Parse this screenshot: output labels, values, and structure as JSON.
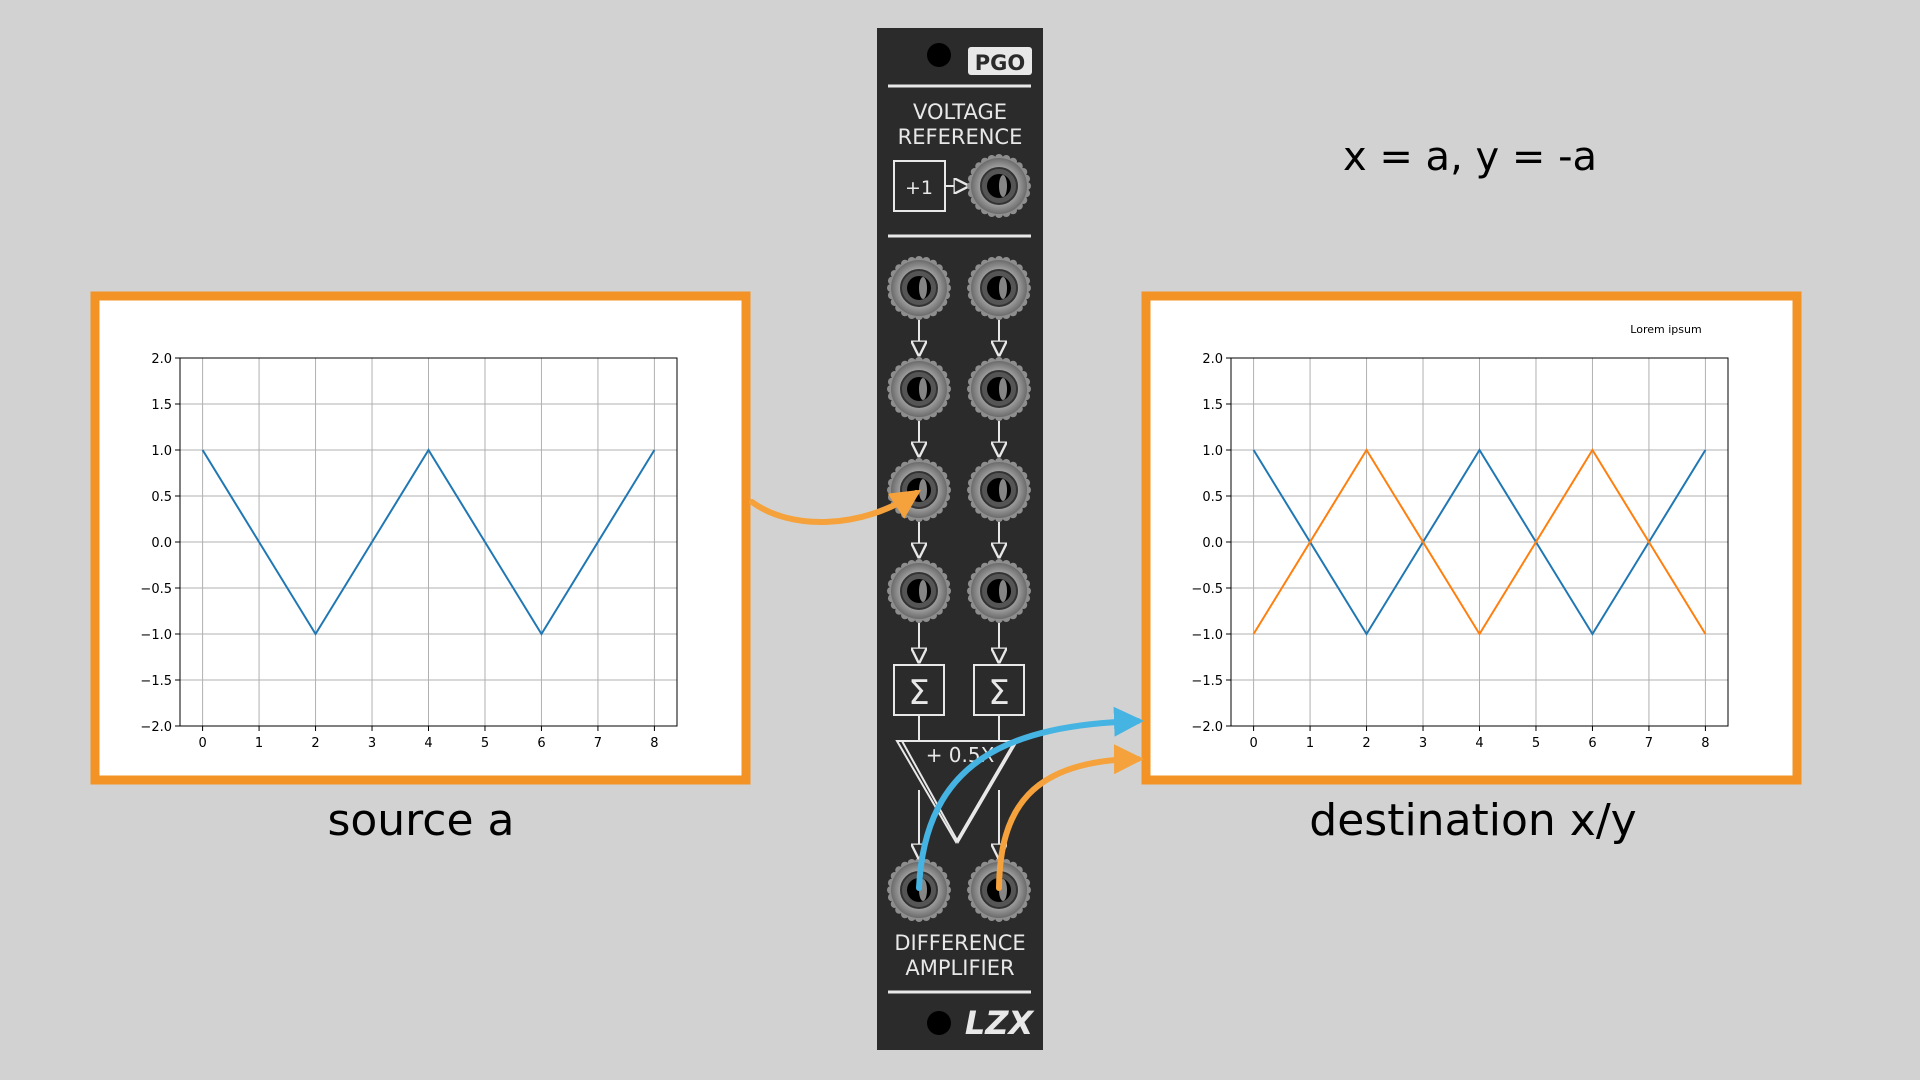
{
  "equation": "x = a, y = -a",
  "captions": {
    "source": "source a",
    "destination": "destination x/y"
  },
  "module": {
    "badge": "PGO",
    "section_top": [
      "VOLTAGE",
      "REFERENCE"
    ],
    "ref_box": "+1",
    "gain_label": "+ 0.5X",
    "sum_symbol": "Σ",
    "section_bottom": [
      "DIFFERENCE",
      "AMPLIFIER"
    ],
    "logo": "LZX",
    "colors": {
      "panel": "#2b2b2b",
      "ink": "#e8e8e8"
    }
  },
  "wire_colors": {
    "orange": "#f5a23c",
    "blue": "#45b4e3",
    "frame": "#f39325"
  },
  "chart_data": [
    {
      "type": "line",
      "title": "",
      "xlabel": "",
      "ylabel": "",
      "xlim": [
        -0.4,
        8.4
      ],
      "ylim": [
        -2.0,
        2.0
      ],
      "xticks": [
        "0",
        "1",
        "2",
        "3",
        "4",
        "5",
        "6",
        "7",
        "8"
      ],
      "yticks": [
        "2.0",
        "1.5",
        "1.0",
        "0.5",
        "0.0",
        "−0.5",
        "−1.0",
        "−1.5",
        "−2.0"
      ],
      "grid": true,
      "series": [
        {
          "color": "#1f77b4",
          "x": [
            0,
            2,
            4,
            6,
            8
          ],
          "y": [
            1,
            -1,
            1,
            -1,
            1
          ]
        }
      ]
    },
    {
      "type": "line",
      "title": "",
      "annotation": "Lorem ipsum",
      "xlabel": "",
      "ylabel": "",
      "xlim": [
        -0.4,
        8.4
      ],
      "ylim": [
        -2.0,
        2.0
      ],
      "xticks": [
        "0",
        "1",
        "2",
        "3",
        "4",
        "5",
        "6",
        "7",
        "8"
      ],
      "yticks": [
        "2.0",
        "1.5",
        "1.0",
        "0.5",
        "0.0",
        "−0.5",
        "−1.0",
        "−1.5",
        "−2.0"
      ],
      "grid": true,
      "series": [
        {
          "color": "#1f77b4",
          "x": [
            0,
            2,
            4,
            6,
            8
          ],
          "y": [
            1,
            -1,
            1,
            -1,
            1
          ]
        },
        {
          "color": "#ff7f0e",
          "x": [
            0,
            2,
            4,
            6,
            8
          ],
          "y": [
            -1,
            1,
            -1,
            1,
            -1
          ]
        }
      ]
    }
  ]
}
